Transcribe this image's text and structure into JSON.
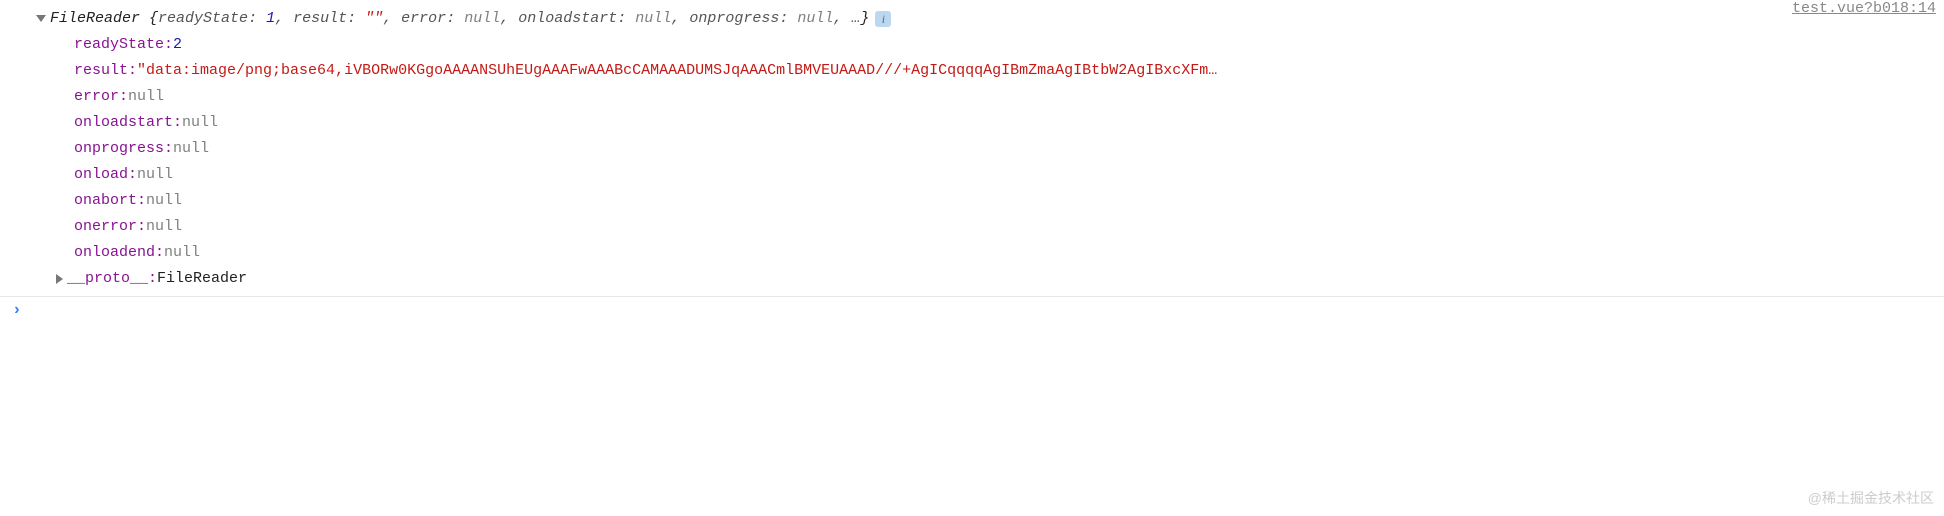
{
  "sourceLink": "test.vue?b018:14",
  "header": {
    "className": "FileReader",
    "preview": [
      {
        "key": "readyState",
        "type": "num",
        "value": "1"
      },
      {
        "key": "result",
        "type": "str",
        "value": "\"\""
      },
      {
        "key": "error",
        "type": "null",
        "value": "null"
      },
      {
        "key": "onloadstart",
        "type": "null",
        "value": "null"
      },
      {
        "key": "onprogress",
        "type": "null",
        "value": "null"
      }
    ],
    "ellipsis": ", …"
  },
  "props": {
    "readyState": {
      "key": "readyState",
      "type": "num",
      "value": "2"
    },
    "result": {
      "key": "result",
      "type": "str",
      "value": "\"data:image/png;base64,iVBORw0KGgoAAAANSUhEUgAAAFwAAABcCAMAAADUMSJqAAACmlBMVEUAAAD///+AgICqqqqAgIBmZmaAgIBtbW2AgIBxcXFm…"
    },
    "error": {
      "key": "error",
      "type": "null",
      "value": "null"
    },
    "onloadstart": {
      "key": "onloadstart",
      "type": "null",
      "value": "null"
    },
    "onprogress": {
      "key": "onprogress",
      "type": "null",
      "value": "null"
    },
    "onload": {
      "key": "onload",
      "type": "null",
      "value": "null"
    },
    "onabort": {
      "key": "onabort",
      "type": "null",
      "value": "null"
    },
    "onerror": {
      "key": "onerror",
      "type": "null",
      "value": "null"
    },
    "onloadend": {
      "key": "onloadend",
      "type": "null",
      "value": "null"
    }
  },
  "proto": {
    "key": "__proto__",
    "value": "FileReader"
  },
  "infoIcon": "i",
  "prompt": "›",
  "watermark": "@稀土掘金技术社区"
}
